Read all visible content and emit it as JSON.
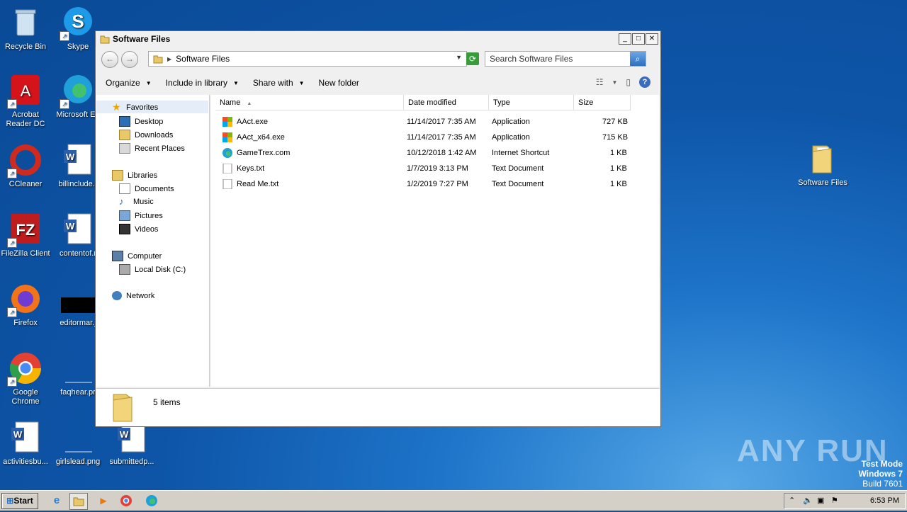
{
  "desktop": {
    "icons": [
      {
        "label": "Recycle Bin"
      },
      {
        "label": "Skype"
      },
      {
        "label": "Acrobat Reader DC"
      },
      {
        "label": "Microsoft Ed"
      },
      {
        "label": "CCleaner"
      },
      {
        "label": "billinclude.r"
      },
      {
        "label": "FileZilla Client"
      },
      {
        "label": "contentof.r"
      },
      {
        "label": "Firefox"
      },
      {
        "label": "editormar.j"
      },
      {
        "label": "Google Chrome"
      },
      {
        "label": "faqhear.pr"
      },
      {
        "label": "activitiesbu..."
      },
      {
        "label": "girlslead.png"
      },
      {
        "label": "submittedp..."
      },
      {
        "label": "Software Files"
      }
    ]
  },
  "window": {
    "title": "Software Files",
    "address": "Software Files",
    "search_placeholder": "Search Software Files",
    "toolbar": {
      "organize": "Organize",
      "include": "Include in library",
      "share": "Share with",
      "new_folder": "New folder"
    },
    "nav": {
      "favorites": "Favorites",
      "desktop": "Desktop",
      "downloads": "Downloads",
      "recent": "Recent Places",
      "libraries": "Libraries",
      "documents": "Documents",
      "music": "Music",
      "pictures": "Pictures",
      "videos": "Videos",
      "computer": "Computer",
      "localdisk": "Local Disk (C:)",
      "network": "Network"
    },
    "columns": {
      "name": "Name",
      "date": "Date modified",
      "type": "Type",
      "size": "Size"
    },
    "files": [
      {
        "name": "AAct.exe",
        "date": "11/14/2017 7:35 AM",
        "type": "Application",
        "size": "727 KB",
        "icon": "app-icon"
      },
      {
        "name": "AAct_x64.exe",
        "date": "11/14/2017 7:35 AM",
        "type": "Application",
        "size": "715 KB",
        "icon": "app-icon"
      },
      {
        "name": "GameTrex.com",
        "date": "10/12/2018 1:42 AM",
        "type": "Internet Shortcut",
        "size": "1 KB",
        "icon": "edge-icon"
      },
      {
        "name": "Keys.txt",
        "date": "1/7/2019 3:13 PM",
        "type": "Text Document",
        "size": "1 KB",
        "icon": "text-file-icon"
      },
      {
        "name": "Read Me.txt",
        "date": "1/2/2019 7:27 PM",
        "type": "Text Document",
        "size": "1 KB",
        "icon": "text-file-icon"
      }
    ],
    "status": "5 items"
  },
  "taskbar": {
    "start": "Start",
    "clock": "6:53 PM"
  },
  "watermark": "ANY RUN",
  "testmode": {
    "line1": "Test Mode",
    "line2": "Windows 7",
    "line3": "Build 7601"
  }
}
